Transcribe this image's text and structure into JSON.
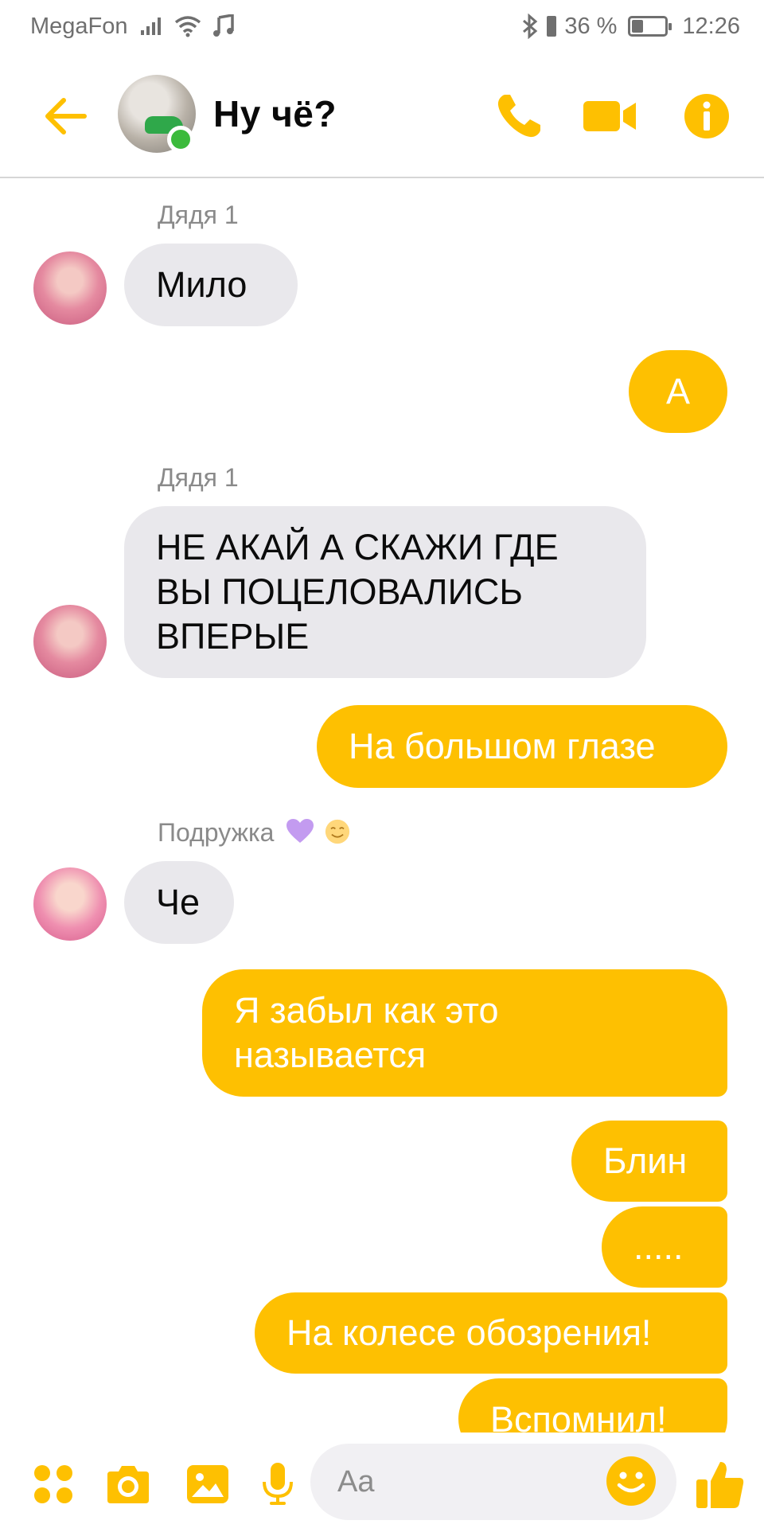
{
  "status_bar": {
    "carrier": "MegaFon",
    "battery_text": "36 %",
    "battery_level": 0.36,
    "time": "12:26"
  },
  "header": {
    "title": "Ну чё?",
    "online": true
  },
  "messages": [
    {
      "sender": "Дядя 1"
    },
    {
      "direction": "incoming",
      "lines": [
        "Мило"
      ]
    },
    {
      "direction": "outgoing",
      "lines": [
        "А"
      ]
    },
    {
      "sender": "Дядя 1"
    },
    {
      "direction": "incoming",
      "lines": [
        "НЕ АКАЙ А СКАЖИ ГДЕ",
        "ВЫ ПОЦЕЛОВАЛИСЬ",
        "ВПЕРЫЕ"
      ]
    },
    {
      "direction": "outgoing",
      "lines": [
        "На большом глазе"
      ]
    },
    {
      "sender": "Подружка"
    },
    {
      "direction": "incoming",
      "lines": [
        "Че"
      ]
    },
    {
      "direction": "outgoing",
      "lines": [
        "Я забыл как это",
        "называется"
      ]
    },
    {
      "direction": "outgoing",
      "lines": [
        "Блин"
      ]
    },
    {
      "direction": "outgoing",
      "lines": [
        "....."
      ]
    },
    {
      "direction": "outgoing",
      "lines": [
        "На колесе обозрения!"
      ]
    },
    {
      "direction": "outgoing",
      "lines": [
        "Вспомнил!"
      ]
    }
  ],
  "chat": {
    "sender_1": "Дядя 1",
    "sender_2": "Подружка",
    "m1": "Мило",
    "m2": "А",
    "m3_l1": "НЕ АКАЙ А СКАЖИ ГДЕ",
    "m3_l2": "ВЫ ПОЦЕЛОВАЛИСЬ",
    "m3_l3": "ВПЕРЫЕ",
    "m4": "На большом глазе",
    "m5": "Че",
    "m6_l1": "Я забыл как это",
    "m6_l2": "называется",
    "m7": "Блин",
    "m8": ".....",
    "m9": "На колесе обозрения!",
    "m10": "Вспомнил!"
  },
  "composer": {
    "placeholder": "Aa"
  },
  "colors": {
    "accent": "#fec001",
    "incoming_bubble": "#e9e8ec",
    "online": "#3cba3c"
  },
  "icons": [
    "signal-icon",
    "wifi-icon",
    "music-icon",
    "bluetooth-icon",
    "battery-icon",
    "back-arrow-icon",
    "phone-icon",
    "video-icon",
    "info-icon",
    "apps-icon",
    "camera-icon",
    "gallery-icon",
    "microphone-icon",
    "emoji-icon",
    "thumbs-up-icon"
  ]
}
